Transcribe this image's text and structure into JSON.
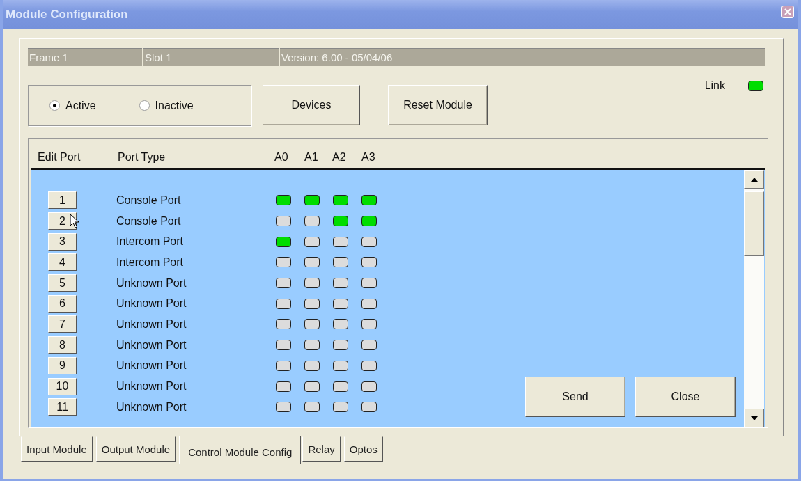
{
  "window": {
    "title": "Module Configuration"
  },
  "info_bar": [
    "Frame 1",
    "Slot 1",
    "Version: 6.00 - 05/04/06"
  ],
  "link": {
    "label": "Link",
    "on": true
  },
  "mode": [
    {
      "label": "Active",
      "selected": true
    },
    {
      "label": "Inactive",
      "selected": false
    }
  ],
  "buttons": [
    "Devices",
    "Reset Module"
  ],
  "ports": {
    "columns": [
      "Edit Port",
      "Port Type",
      "A0",
      "A1",
      "A2",
      "A3"
    ],
    "rows": [
      {
        "number": "1",
        "type": "Console Port",
        "leds": [
          {
            "on": true
          },
          {
            "on": true
          },
          {
            "on": true
          },
          {
            "on": true
          }
        ]
      },
      {
        "number": "2",
        "type": "Console Port",
        "leds": [
          {
            "on": false
          },
          {
            "on": false
          },
          {
            "on": true
          },
          {
            "on": true
          }
        ]
      },
      {
        "number": "3",
        "type": "Intercom Port",
        "leds": [
          {
            "on": true
          },
          {
            "on": false
          },
          {
            "on": false
          },
          {
            "on": false
          }
        ]
      },
      {
        "number": "4",
        "type": "Intercom Port",
        "leds": [
          {
            "on": false
          },
          {
            "on": false
          },
          {
            "on": false
          },
          {
            "on": false
          }
        ]
      },
      {
        "number": "5",
        "type": "Unknown Port",
        "leds": [
          {
            "on": false
          },
          {
            "on": false
          },
          {
            "on": false
          },
          {
            "on": false
          }
        ]
      },
      {
        "number": "6",
        "type": "Unknown Port",
        "leds": [
          {
            "on": false
          },
          {
            "on": false
          },
          {
            "on": false
          },
          {
            "on": false
          }
        ]
      },
      {
        "number": "7",
        "type": "Unknown Port",
        "leds": [
          {
            "on": false
          },
          {
            "on": false
          },
          {
            "on": false
          },
          {
            "on": false
          }
        ]
      },
      {
        "number": "8",
        "type": "Unknown Port",
        "leds": [
          {
            "on": false
          },
          {
            "on": false
          },
          {
            "on": false
          },
          {
            "on": false
          }
        ]
      },
      {
        "number": "9",
        "type": "Unknown Port",
        "leds": [
          {
            "on": false
          },
          {
            "on": false
          },
          {
            "on": false
          },
          {
            "on": false
          }
        ]
      },
      {
        "number": "10",
        "type": "Unknown Port",
        "leds": [
          {
            "on": false
          },
          {
            "on": false
          },
          {
            "on": false
          },
          {
            "on": false
          }
        ]
      },
      {
        "number": "11",
        "type": "Unknown Port",
        "leds": [
          {
            "on": false
          },
          {
            "on": false
          },
          {
            "on": false
          },
          {
            "on": false
          }
        ]
      }
    ]
  },
  "actions": [
    "Send",
    "Close"
  ],
  "tabs": [
    {
      "label": "Input Module",
      "selected": false
    },
    {
      "label": "Output Module",
      "selected": false
    },
    {
      "label": "Control Module Config",
      "selected": true
    },
    {
      "label": "Relay",
      "selected": false
    },
    {
      "label": "Optos",
      "selected": false
    }
  ]
}
